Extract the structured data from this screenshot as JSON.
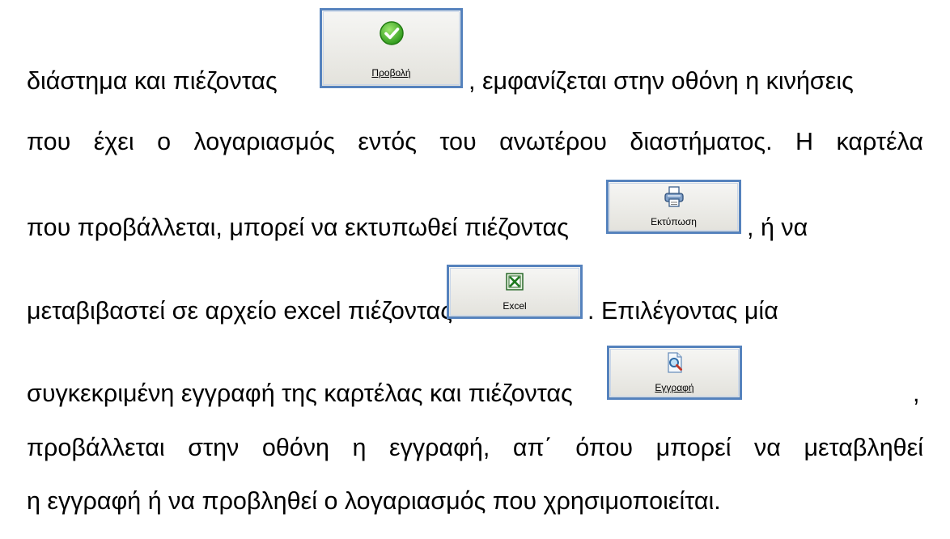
{
  "lines": {
    "l1a": "διάστημα και πιέζοντας",
    "l1b": ", εμφανίζεται στην οθόνη η κινήσεις",
    "l2": "που έχει ο λογαριασμός εντός του ανωτέρου διαστήματος. Η καρτέλα",
    "l3a": "που προβάλλεται, μπορεί να εκτυπωθεί πιέζοντας",
    "l3b": ", ή να",
    "l4a": "μεταβιβαστεί σε αρχείο excel πιέζοντας",
    "l4b": ". Επιλέγοντας μία",
    "l5a": "συγκεκριμένη εγγραφή της καρτέλας και πιέζοντας",
    "l5b": ",",
    "l6": "προβάλλεται στην οθόνη η εγγραφή, απ΄ όπου μπορεί να μεταβληθεί",
    "l7": "η εγγραφή ή να προβληθεί ο λογαριασμός που χρησιμοποιείται."
  },
  "buttons": {
    "view": {
      "label": "Προβολή",
      "icon": "check-circle-icon"
    },
    "print": {
      "label": "Εκτύπωση",
      "icon": "printer-icon"
    },
    "excel": {
      "label": "Excel",
      "icon": "excel-icon"
    },
    "record": {
      "label": "Εγγραφή",
      "icon": "document-search-icon"
    }
  }
}
